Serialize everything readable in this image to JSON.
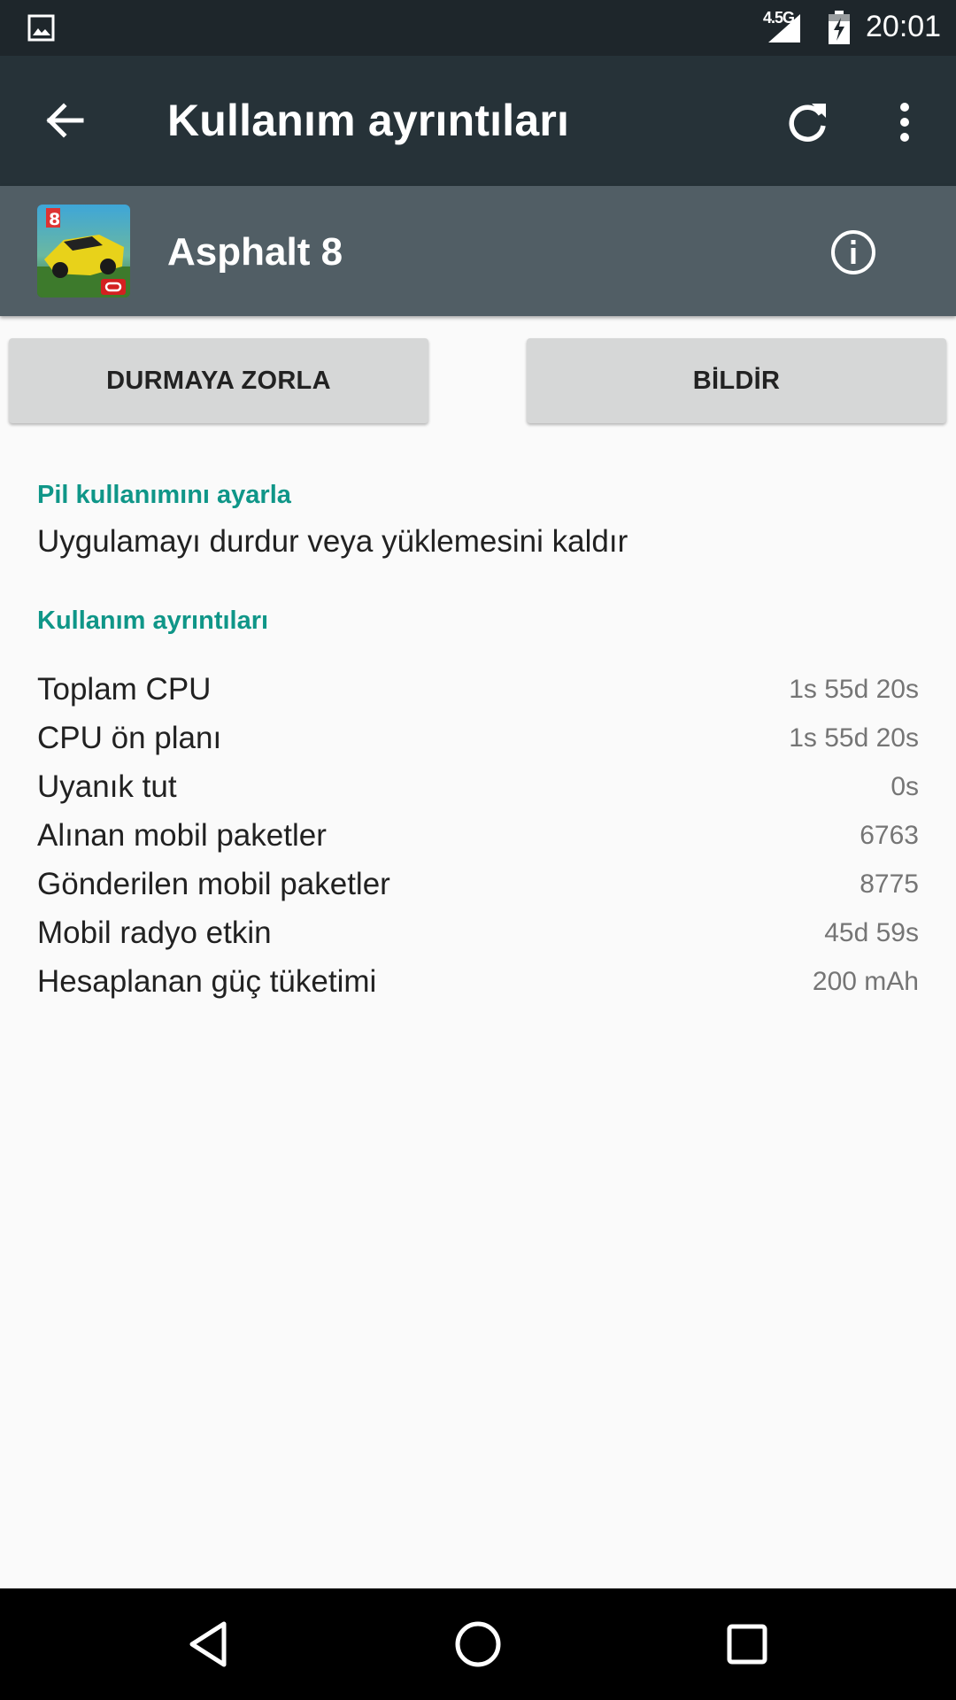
{
  "status_bar": {
    "network_type": "4.5G",
    "time": "20:01"
  },
  "toolbar": {
    "title": "Kullanım ayrıntıları"
  },
  "app": {
    "name": "Asphalt 8"
  },
  "buttons": {
    "force_stop": "DURMAYA ZORLA",
    "report": "BİLDİR"
  },
  "battery_section": {
    "header": "Pil kullanımını ayarla",
    "summary": "Uygulamayı durdur veya yüklemesini kaldır"
  },
  "usage_section": {
    "header": "Kullanım ayrıntıları",
    "rows": [
      {
        "label": "Toplam CPU",
        "value": "1s 55d 20s"
      },
      {
        "label": "CPU ön planı",
        "value": "1s 55d 20s"
      },
      {
        "label": "Uyanık tut",
        "value": "0s"
      },
      {
        "label": "Alınan mobil paketler",
        "value": "6763"
      },
      {
        "label": "Gönderilen mobil paketler",
        "value": "8775"
      },
      {
        "label": "Mobil radyo etkin",
        "value": "45d 59s"
      },
      {
        "label": "Hesaplanan güç tüketimi",
        "value": "200 mAh"
      }
    ]
  },
  "colors": {
    "toolbar": "#263238",
    "app_header": "#515e65",
    "accent": "#0f9688"
  }
}
